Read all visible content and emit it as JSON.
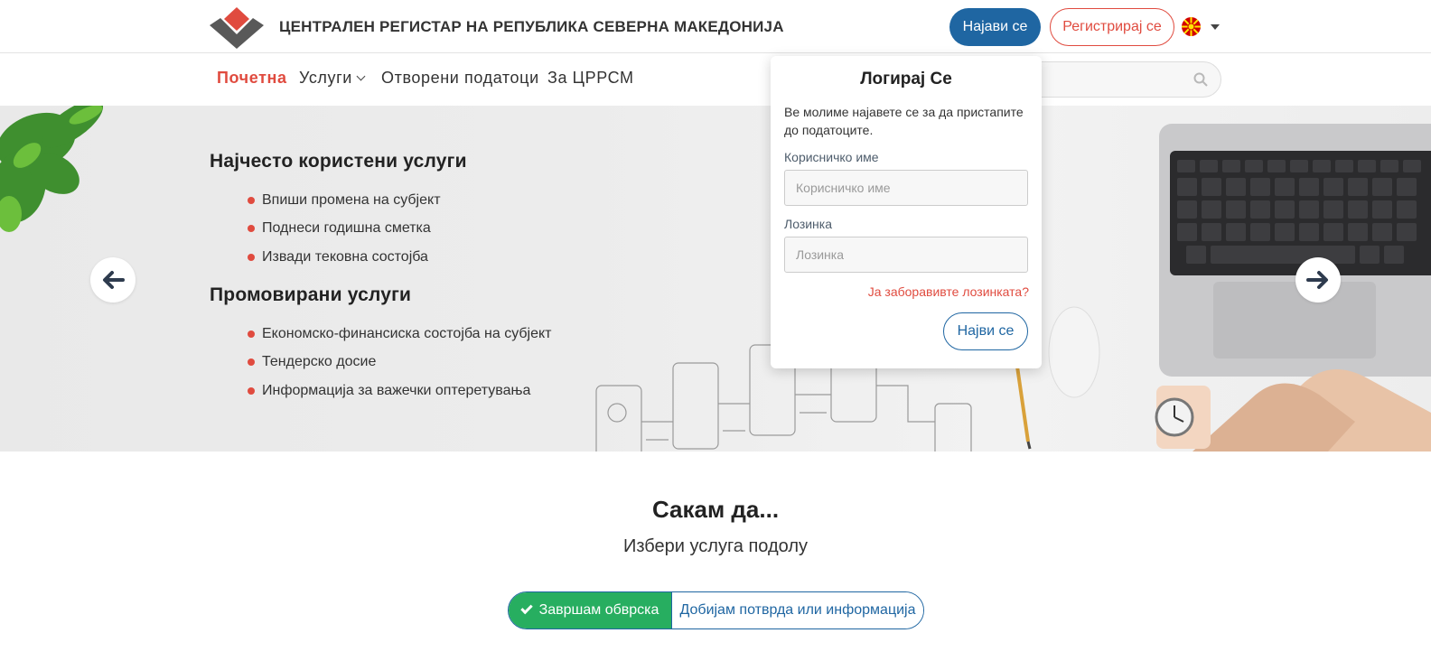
{
  "header": {
    "org_title": "ЦЕНТРАЛЕН РЕГИСТАР НА РЕПУБЛИКА СЕВЕРНА МАКЕДОНИЈА",
    "login_label": "Најави се",
    "register_label": "Регистрирај се",
    "language_flag": "macedonia-flag-icon"
  },
  "nav": {
    "items": [
      {
        "label": "Почетна",
        "active": true
      },
      {
        "label": "Услуги",
        "dropdown": true
      },
      {
        "label": "Отворени податоци"
      },
      {
        "label": "За ЦРРСМ"
      }
    ],
    "search_placeholder": ""
  },
  "hero": {
    "section1_title": "Најчесто користени услуги",
    "section1_items": [
      "Впиши промена на субјект",
      "Поднеси годишна сметка",
      "Извади тековна состојба"
    ],
    "section2_title": "Промовирани услуги",
    "section2_items": [
      "Економско-финансиска состојба на субјект",
      "Тендерско досие",
      "Информација за важечки оптеретувања"
    ]
  },
  "login_popover": {
    "title": "Логирај Се",
    "description": "Ве молиме најавете се за да пристапите до податоците.",
    "username_label": "Корисничко име",
    "username_placeholder": "Корисничко име",
    "password_label": "Лозинка",
    "password_placeholder": "Лозинка",
    "forgot_label": "Ја заборавивте лозинката?",
    "submit_label": "Најви се"
  },
  "want": {
    "title": "Сакам да...",
    "subtitle": "Избери услуга подолу",
    "option_a": "Завршам обврска",
    "option_b": "Добијам потврда или информација"
  },
  "colors": {
    "primary": "#1f66a2",
    "accent": "#e04b3f",
    "success": "#27ae60"
  }
}
